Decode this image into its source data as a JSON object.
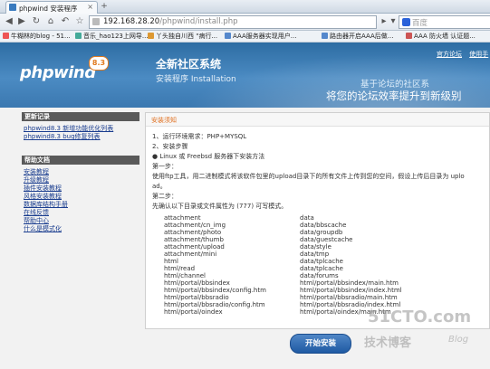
{
  "browser": {
    "tab_title": "phpwind 安装程序",
    "url_host": "192.168.28.20",
    "url_path": "/phpwind/install.php",
    "search_placeholder": "百度",
    "bookmarks": [
      "牛糊林的blog - 51...",
      "音乐_hao123上网导...",
      "丫头独自川西 \"病行...",
      "AAA服务器实现用户...",
      "路由器开启AAA后做...",
      "AAA 防火墙 认证题..."
    ]
  },
  "header": {
    "logo_text": "phpwind",
    "logo_version": "8.3",
    "title": "全新社区系统",
    "subtitle": "安装程序 Installation",
    "links": [
      "官方论坛",
      "使用手"
    ],
    "slogan_line1": "基于论坛的社区系",
    "slogan_line2": "将您的论坛效率提升到新级别"
  },
  "sidebar": {
    "section1_title": "更新记录",
    "section1_links": [
      "phpwind8.3 新增功能优化列表",
      "phpwind8.3 bug修复列表"
    ],
    "section2_title": "帮助文档",
    "section2_links": [
      "安装教程",
      "升级教程",
      "插件安装教程",
      "风格安装教程",
      "数据库结构手册",
      "在线反馈",
      "帮助中心",
      "什么是模式化"
    ]
  },
  "panel": {
    "title": "安装须知",
    "lines": [
      "1、运行环境需求：PHP+MYSQL",
      "2、安装步骤",
      "● Linux 或 Freebsd 服务器下安装方法",
      "第一步：",
      "使用ftp工具，用二进制模式将该软件包里的upload目录下的所有文件上传到您的空间，假设上传后目录为 uplo",
      "ad。",
      "第二步：",
      "先确认以下目录或文件属性为 (777) 可写模式。"
    ],
    "dirs_left": [
      "attachment",
      "attachment/cn_img",
      "attachment/photo",
      "attachment/thumb",
      "attachment/upload",
      "attachment/mini",
      "html",
      "html/read",
      "html/channel",
      "html/portal/bbsindex",
      "html/portal/bbsindex/config.htm",
      "html/portal/bbsradio",
      "html/portal/bbsradio/config.htm",
      "html/portal/oindex"
    ],
    "dirs_right": [
      "data",
      "data/bbscache",
      "data/groupdb",
      "data/guestcache",
      "data/style",
      "data/tmp",
      "data/tplcache",
      "data/tplcache",
      "data/forums",
      "html/portal/bbsindex/main.htm",
      "html/portal/bbsindex/index.html",
      "html/portal/bbsradio/main.htm",
      "html/portal/bbsradio/index.html",
      "html/portal/oindex/main.htm"
    ]
  },
  "install_button": "开始安装",
  "watermark": {
    "line1": "51CTO.com",
    "line2": "技术博客",
    "line3": "Blog"
  },
  "colors": {
    "header_blue": "#3b78b0",
    "panel_title": "#e07020",
    "link_blue": "#1a3d8f",
    "button_blue": "#1f5aa3"
  }
}
